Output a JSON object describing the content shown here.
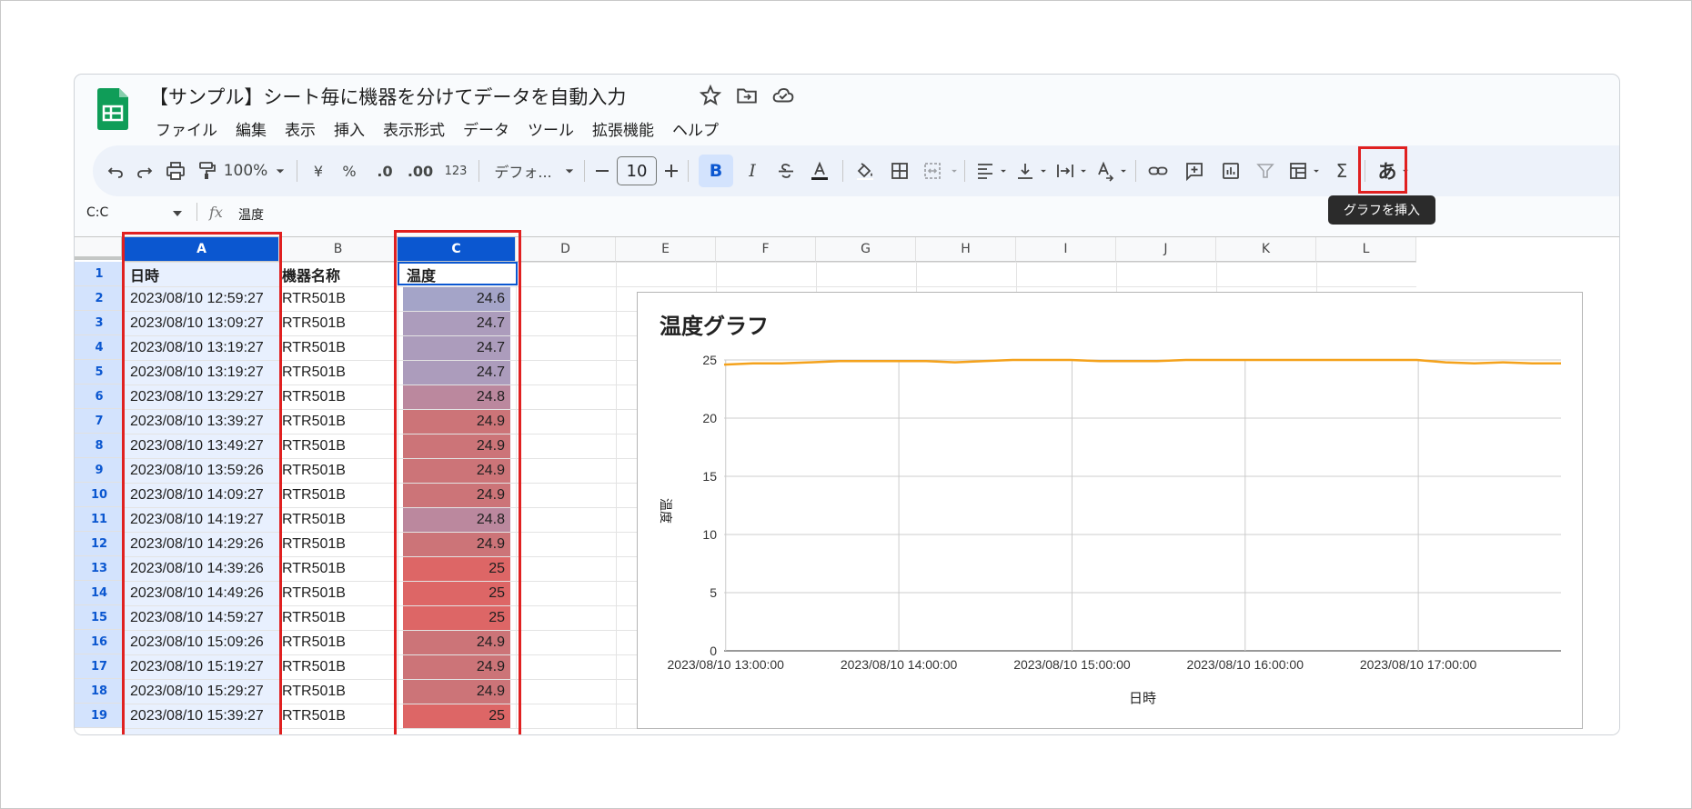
{
  "doc": {
    "title": "【サンプル】シート毎に機器を分けてデータを自動入力"
  },
  "menu": [
    "ファイル",
    "編集",
    "表示",
    "挿入",
    "表示形式",
    "データ",
    "ツール",
    "拡張機能",
    "ヘルプ"
  ],
  "toolbar": {
    "zoom": "100%",
    "currency": "¥",
    "percent": "%",
    "dec_decrease": ".0",
    "dec_increase": ".00",
    "number_format": "123",
    "font": "デフォ...",
    "font_size": "10",
    "bold": "B",
    "italic": "I",
    "input_tools": "あ",
    "tooltip": "グラフを挿入"
  },
  "formula_bar": {
    "range": "C:C",
    "fx": "fx",
    "content": "温度"
  },
  "columns": [
    "A",
    "B",
    "C",
    "D",
    "E",
    "F",
    "G",
    "H",
    "I",
    "J",
    "K",
    "L"
  ],
  "rows": [
    {
      "n": "1",
      "a": "日時",
      "b": "機器名称",
      "c": "温度"
    },
    {
      "n": "2",
      "a": "2023/08/10 12:59:27",
      "b": "RTR501B",
      "c": "24.6"
    },
    {
      "n": "3",
      "a": "2023/08/10 13:09:27",
      "b": "RTR501B",
      "c": "24.7"
    },
    {
      "n": "4",
      "a": "2023/08/10 13:19:27",
      "b": "RTR501B",
      "c": "24.7"
    },
    {
      "n": "5",
      "a": "2023/08/10 13:19:27",
      "b": "RTR501B",
      "c": "24.7"
    },
    {
      "n": "6",
      "a": "2023/08/10 13:29:27",
      "b": "RTR501B",
      "c": "24.8"
    },
    {
      "n": "7",
      "a": "2023/08/10 13:39:27",
      "b": "RTR501B",
      "c": "24.9"
    },
    {
      "n": "8",
      "a": "2023/08/10 13:49:27",
      "b": "RTR501B",
      "c": "24.9"
    },
    {
      "n": "9",
      "a": "2023/08/10 13:59:26",
      "b": "RTR501B",
      "c": "24.9"
    },
    {
      "n": "10",
      "a": "2023/08/10 14:09:27",
      "b": "RTR501B",
      "c": "24.9"
    },
    {
      "n": "11",
      "a": "2023/08/10 14:19:27",
      "b": "RTR501B",
      "c": "24.8"
    },
    {
      "n": "12",
      "a": "2023/08/10 14:29:26",
      "b": "RTR501B",
      "c": "24.9"
    },
    {
      "n": "13",
      "a": "2023/08/10 14:39:26",
      "b": "RTR501B",
      "c": "25"
    },
    {
      "n": "14",
      "a": "2023/08/10 14:49:26",
      "b": "RTR501B",
      "c": "25"
    },
    {
      "n": "15",
      "a": "2023/08/10 14:59:27",
      "b": "RTR501B",
      "c": "25"
    },
    {
      "n": "16",
      "a": "2023/08/10 15:09:26",
      "b": "RTR501B",
      "c": "24.9"
    },
    {
      "n": "17",
      "a": "2023/08/10 15:19:27",
      "b": "RTR501B",
      "c": "24.9"
    },
    {
      "n": "18",
      "a": "2023/08/10 15:29:27",
      "b": "RTR501B",
      "c": "24.9"
    },
    {
      "n": "19",
      "a": "2023/08/10 15:39:27",
      "b": "RTR501B",
      "c": "25"
    }
  ],
  "heat_colors": {
    "24.6": "#a4a4c8",
    "24.7": "#ac9cbc",
    "24.8": "#bb889e",
    "24.9": "#cc7478",
    "25": "#dd6666"
  },
  "chart_data": {
    "type": "line",
    "title": "温度グラフ",
    "xlabel": "日時",
    "ylabel": "温度",
    "ylim": [
      0,
      25
    ],
    "yticks": [
      "0",
      "5",
      "10",
      "15",
      "20",
      "25"
    ],
    "xticks": [
      "2023/08/10 13:00:00",
      "2023/08/10 14:00:00",
      "2023/08/10 15:00:00",
      "2023/08/10 16:00:00",
      "2023/08/10 17:00:00"
    ],
    "xlim": [
      "2023/08/10 12:59:27",
      "2023/08/10 17:49:27"
    ],
    "grid": true,
    "color": "#f4a21c",
    "series": [
      {
        "x": [
          "2023/08/10 12:59:27",
          "2023/08/10 13:09:27",
          "2023/08/10 13:19:27",
          "2023/08/10 13:29:27",
          "2023/08/10 13:39:27",
          "2023/08/10 13:49:27",
          "2023/08/10 13:59:26",
          "2023/08/10 14:09:27",
          "2023/08/10 14:19:27",
          "2023/08/10 14:29:26",
          "2023/08/10 14:39:26",
          "2023/08/10 14:49:26",
          "2023/08/10 14:59:27",
          "2023/08/10 15:09:26",
          "2023/08/10 15:19:27",
          "2023/08/10 15:29:27",
          "2023/08/10 15:39:27",
          "2023/08/10 15:49:27",
          "2023/08/10 15:59:27",
          "2023/08/10 16:09:27",
          "2023/08/10 16:19:27",
          "2023/08/10 16:29:27",
          "2023/08/10 16:39:27",
          "2023/08/10 16:49:27",
          "2023/08/10 16:59:27",
          "2023/08/10 17:09:27",
          "2023/08/10 17:19:27",
          "2023/08/10 17:29:27",
          "2023/08/10 17:39:27",
          "2023/08/10 17:49:27"
        ],
        "values": [
          24.6,
          24.7,
          24.7,
          24.8,
          24.9,
          24.9,
          24.9,
          24.9,
          24.8,
          24.9,
          25,
          25,
          25,
          24.9,
          24.9,
          24.9,
          25,
          25,
          25,
          25,
          25,
          25,
          25,
          25,
          25,
          24.8,
          24.7,
          24.8,
          24.7,
          24.7
        ]
      }
    ]
  }
}
